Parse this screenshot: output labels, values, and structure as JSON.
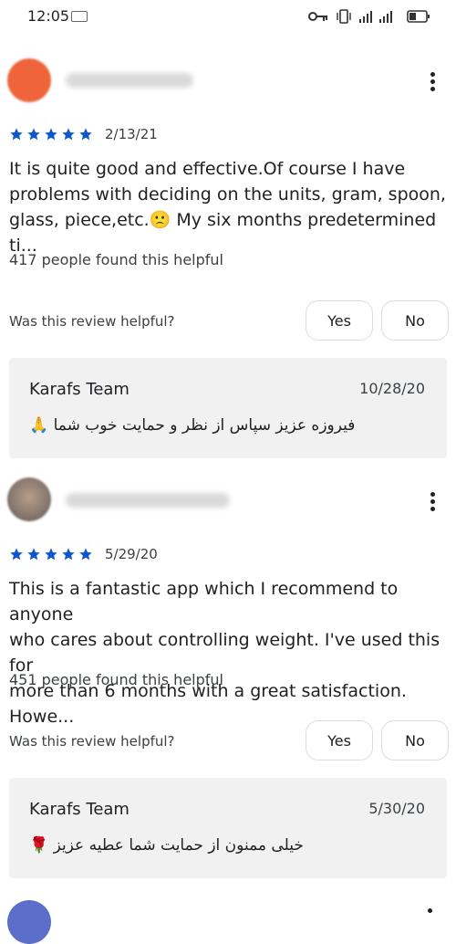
{
  "status_bar": {
    "time": "12:05",
    "icons": [
      "key-icon",
      "vibrate-icon",
      "signal-icon",
      "battery-icon"
    ]
  },
  "reviews": [
    {
      "author": "",
      "date": "2/13/21",
      "rating": 5,
      "text_lines": [
        "It is quite good and effective.Of course I have",
        "problems with deciding on the units, gram, spoon,",
        "glass, piece,etc.🙁 My six months predetermined ti..."
      ],
      "helpful_count": "417 people found this helpful",
      "helpful_question": "Was this review helpful?",
      "yes_label": "Yes",
      "no_label": "No",
      "reply": {
        "author": "Karafs Team",
        "date": "10/28/20",
        "text": "فیروزه عزیز سپاس از نظر و حمایت خوب شما 🙏"
      }
    },
    {
      "author": "",
      "date": "5/29/20",
      "rating": 5,
      "text_lines": [
        "This is a fantastic app which I recommend to anyone",
        "who cares about controlling weight. I've used this for",
        "more than 6 months with a great satisfaction. Howe..."
      ],
      "helpful_count": "451 people found this helpful",
      "helpful_question": "Was this review helpful?",
      "yes_label": "Yes",
      "no_label": "No",
      "reply": {
        "author": "Karafs Team",
        "date": "5/30/20",
        "text": "خیلی ممنون از حمایت شما عطیه عزیز 🌹"
      }
    }
  ],
  "colors": {
    "star": "#0b57d0",
    "reply_bg": "#f1f1f1",
    "avatar_1": "#f0643c",
    "avatar_2": "#8a7a70"
  }
}
